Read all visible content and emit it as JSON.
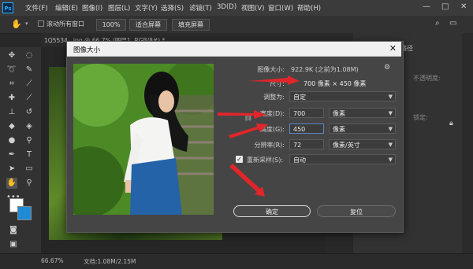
{
  "app": {
    "logo": "Ps"
  },
  "menu": [
    "文件(F)",
    "编辑(E)",
    "图像(I)",
    "图层(L)",
    "文字(Y)",
    "选择(S)",
    "滤镜(T)",
    "3D(D)",
    "视图(V)",
    "窗口(W)",
    "帮助(H)"
  ],
  "window_controls": {
    "minimize": "—",
    "maximize": "□",
    "close": "✕"
  },
  "options_bar": {
    "scroll_all_label": "滚动所有窗口",
    "zoom_100": "100%",
    "fit_screen": "适合屏幕",
    "fill_screen": "填充屏幕"
  },
  "doc_tab": {
    "title": "1Q5534...jpg @ 66.7% (图层1, RGB/8#) *"
  },
  "status": {
    "zoom": "66.67%",
    "doc_info": "文档:1.08M/2.15M"
  },
  "right_panel": {
    "tab_label": "路径",
    "opacity_label": "不透明度:",
    "lock_label": "锁定:"
  },
  "dialog": {
    "title": "图像大小",
    "close": "✕",
    "image_size_label": "图像大小:",
    "image_size_value": "922.9K (之前为1.08M)",
    "dimensions_label": "尺寸:",
    "dimensions_value": "700 像素 × 450 像素",
    "fit_to_label": "调整为:",
    "fit_to_value": "自定",
    "width_label": "宽度(D):",
    "width_value": "700",
    "width_unit": "像素",
    "height_label": "高度(G):",
    "height_value": "450",
    "height_unit": "像素",
    "resolution_label": "分辨率(R):",
    "resolution_value": "72",
    "resolution_unit": "像素/英寸",
    "resample_label": "重新采样(S):",
    "resample_value": "自动",
    "ok_button": "确定",
    "reset_button": "复位"
  },
  "colors": {
    "accent": "#31a8ff",
    "arrow": "#e0262b",
    "dialog_bg": "#454545"
  }
}
